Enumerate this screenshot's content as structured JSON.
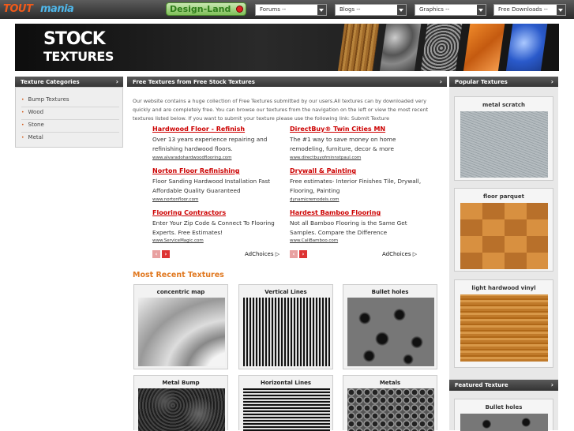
{
  "topbar": {
    "logo_text_1": "TOUT",
    "logo_text_2": "mania",
    "partner_logo": "Design-Land",
    "dropdowns": [
      "Forums --",
      "Blogs --",
      "Graphics --",
      "Free Downloads --"
    ]
  },
  "banner": {
    "line1": "STOCK",
    "line2": "TEXTURES"
  },
  "left_panel": {
    "title": "Texture Categories",
    "items": [
      "Bump Textures",
      "Wood",
      "Stone",
      "Metal"
    ]
  },
  "main_panel": {
    "title": "Free Textures from Free Stock Textures",
    "intro": "Our website contains a huge collection of Free Textures submitted by our users.All textures can by downloaded very quickly and are completely free. You can browse our textures from the navigation on the left or view the most recent textures listed below. If you want to submit your texture please use the following link: Submit Texture"
  },
  "ads_left": [
    {
      "title": "Hardwood Floor - Refinish",
      "desc": "Over 13 years experience repairing and refinishing hardwood floors.",
      "url": "www.alvaradohardwoodflooring.com"
    },
    {
      "title": "Norton Floor Refinishing",
      "desc": "Floor Sanding Hardwood Installation Fast Affordable Quality Guaranteed",
      "url": "www.nortonfloor.com"
    },
    {
      "title": "Flooring Contractors",
      "desc": "Enter Your Zip Code & Connect To Flooring Experts. Free Estimates!",
      "url": "www.ServiceMagic.com"
    }
  ],
  "ads_right": [
    {
      "title": "DirectBuy® Twin Cities MN",
      "desc": "The #1 way to save money on home remodeling, furniture, decor & more",
      "url": "www.directbuyofminnstpaul.com"
    },
    {
      "title": "Drywall & Painting",
      "desc": "Free estimates- Interior Finishes Tile, Drywall, Flooring, Painting",
      "url": "dynamicremodels.com"
    },
    {
      "title": "Hardest Bamboo Flooring",
      "desc": "Not all Bamboo Flooring is the Same Get Samples. Compare the Difference",
      "url": "www.CaliBamboo.com"
    }
  ],
  "adchoices": "AdChoices",
  "recent": {
    "heading": "Most Recent Textures",
    "items": [
      "concentric map",
      "Vertical Lines",
      "Bullet holes",
      "Metal Bump",
      "Horizontal Lines",
      "Metals"
    ]
  },
  "popular": {
    "title": "Popular Textures",
    "items": [
      "metal scratch",
      "floor parquet",
      "light hardwood vinyl"
    ]
  },
  "featured": {
    "title": "Featured Texture",
    "items": [
      "Bullet holes"
    ]
  },
  "colors": {
    "accent": "#e07820",
    "ad_title": "#cc0000",
    "header_bg": "#3a3a3a"
  },
  "arrow": "›"
}
